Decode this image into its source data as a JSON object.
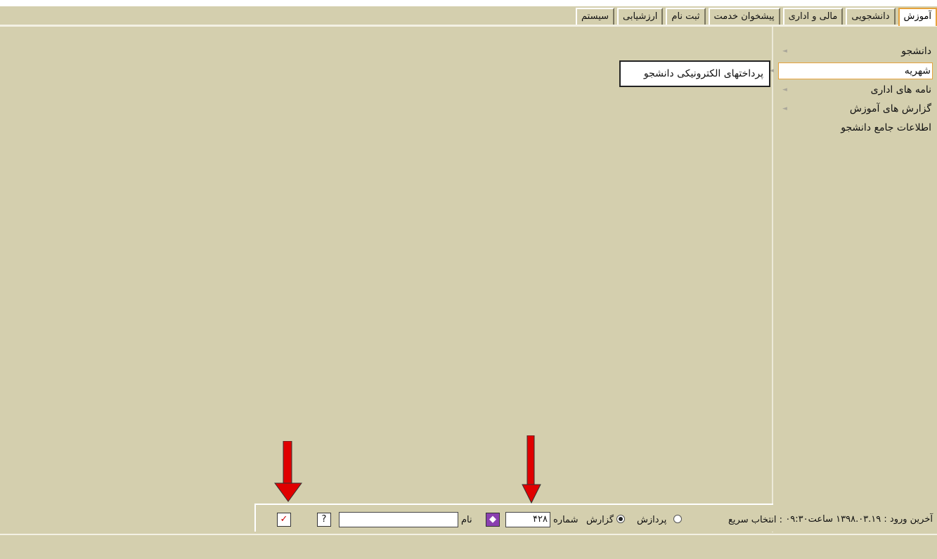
{
  "tabs": [
    {
      "label": "آموزش",
      "active": true
    },
    {
      "label": "دانشجویی",
      "active": false
    },
    {
      "label": "مالی و اداری",
      "active": false
    },
    {
      "label": "پیشخوان خدمت",
      "active": false
    },
    {
      "label": "ثبت نام",
      "active": false
    },
    {
      "label": "ارزشیابی",
      "active": false
    },
    {
      "label": "سیستم",
      "active": false
    }
  ],
  "menu": {
    "items": [
      {
        "label": "دانشجو",
        "has_arrow": true
      },
      {
        "label": "شهریه",
        "has_arrow": true,
        "selected": true
      },
      {
        "label": "نامه های اداری",
        "has_arrow": true
      },
      {
        "label": "گزارش های آموزش",
        "has_arrow": true
      },
      {
        "label": "اطلاعات جامع دانشجو",
        "has_arrow": false
      }
    ],
    "submenu_label": "پرداختهای الکترونیکی دانشجو"
  },
  "last_login": "آخرین ورود : ۱۳۹۸.۰۳.۱۹ ساعت۰۹:۳۰",
  "quick_select": {
    "label": "انتخاب سریع :",
    "option_process": "پردازش",
    "option_report": "گزارش",
    "selected_option": "گزارش",
    "number_label": "شماره",
    "number_value": "۴۲۸",
    "name_label": "نام",
    "name_value": "",
    "help_icon": "help-icon",
    "confirm_icon": "checkmark-icon"
  },
  "colors": {
    "background": "#d4cfae",
    "accent": "#e6a23c",
    "arrow": "#e00000"
  }
}
